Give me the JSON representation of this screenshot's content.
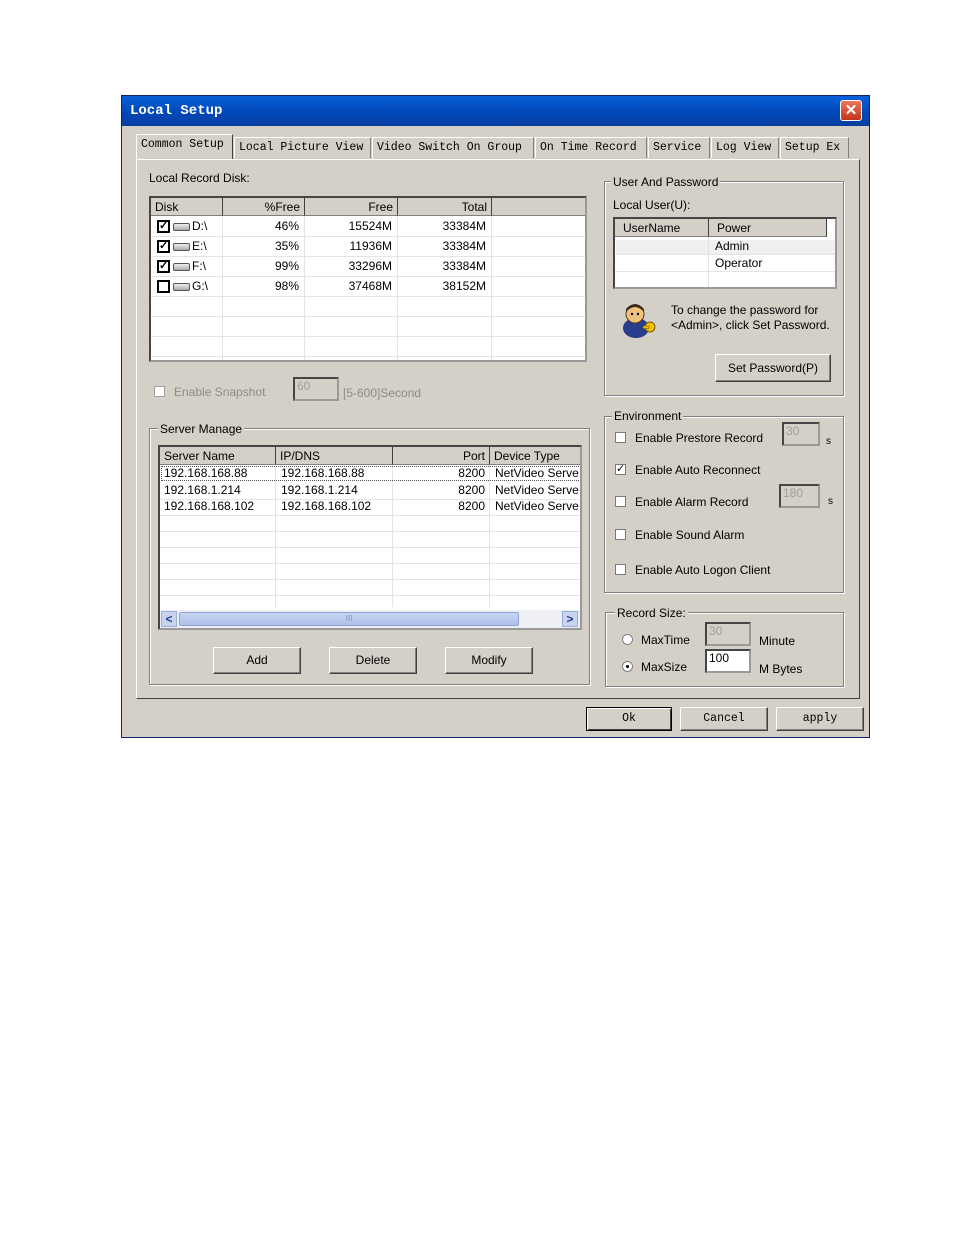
{
  "window": {
    "title": "Local Setup",
    "close_glyph": "✕"
  },
  "tabs": [
    "Common Setup",
    "Local Picture View",
    "Video Switch On Group",
    "On Time Record",
    "Service",
    "Log View",
    "Setup Ex"
  ],
  "disk": {
    "label": "Local Record Disk:",
    "columns": [
      "Disk",
      "%Free",
      "Free",
      "Total"
    ],
    "rows": [
      {
        "checked": true,
        "disk": "D:\\",
        "pct": "46%",
        "free": "15524M",
        "total": "33384M"
      },
      {
        "checked": true,
        "disk": "E:\\",
        "pct": "35%",
        "free": "11936M",
        "total": "33384M"
      },
      {
        "checked": true,
        "disk": "F:\\",
        "pct": "99%",
        "free": "33296M",
        "total": "33384M"
      },
      {
        "checked": false,
        "disk": "G:\\",
        "pct": "98%",
        "free": "37468M",
        "total": "38152M"
      }
    ]
  },
  "snapshot": {
    "label": "Enable Snapshot",
    "value": "60",
    "range": "[5-600]Second"
  },
  "server": {
    "legend": "Server Manage",
    "columns": [
      "Server Name",
      "IP/DNS",
      "Port",
      "Device Type"
    ],
    "rows": [
      {
        "name": "192.168.168.88",
        "ip": "192.168.168.88",
        "port": "8200",
        "type": "NetVideo Serve"
      },
      {
        "name": "192.168.1.214",
        "ip": "192.168.1.214",
        "port": "8200",
        "type": "NetVideo Serve"
      },
      {
        "name": "192.168.168.102",
        "ip": "192.168.168.102",
        "port": "8200",
        "type": "NetVideo Serve"
      }
    ],
    "buttons": {
      "add": "Add",
      "delete": "Delete",
      "modify": "Modify"
    },
    "scroll": {
      "left": "<",
      "right": ">",
      "thumb": "III"
    }
  },
  "user": {
    "legend": "User And Password",
    "local_user": "Local User(U):",
    "columns": [
      "UserName",
      "Power"
    ],
    "rows": [
      {
        "name": "",
        "power": "Admin"
      },
      {
        "name": "",
        "power": "Operator"
      }
    ],
    "hint": "To change the password for <Admin>, click Set Password.",
    "set_password": "Set Password(P)"
  },
  "environment": {
    "legend": "Environment",
    "prestore": {
      "label": "Enable Prestore Record",
      "checked": false,
      "value": "30",
      "unit": "s"
    },
    "auto_reconnect": {
      "label": "Enable Auto Reconnect",
      "checked": true
    },
    "alarm_record": {
      "label": "Enable Alarm Record",
      "checked": false,
      "value": "180",
      "unit": "s"
    },
    "sound_alarm": {
      "label": "Enable Sound Alarm",
      "checked": false
    },
    "auto_logon": {
      "label": "Enable Auto Logon Client",
      "checked": false
    }
  },
  "record_size": {
    "legend": "Record Size:",
    "maxtime": {
      "label": "MaxTime",
      "value": "30",
      "unit": "Minute",
      "selected": false
    },
    "maxsize": {
      "label": "MaxSize",
      "value": "100",
      "unit": "M Bytes",
      "selected": true
    }
  },
  "footer": {
    "ok": "Ok",
    "cancel": "Cancel",
    "apply": "apply"
  },
  "colors": {
    "titlebar": "#0148b8",
    "dialog": "#d4d0c8",
    "selection": "#316ac5"
  }
}
